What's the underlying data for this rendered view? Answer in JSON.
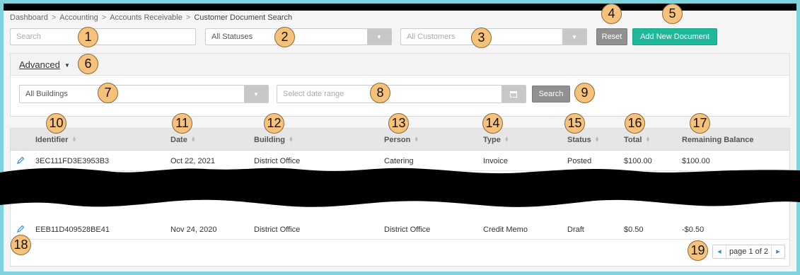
{
  "breadcrumb": {
    "items": [
      "Dashboard",
      "Accounting",
      "Accounts Receivable"
    ],
    "current": "Customer Document Search",
    "separator": ">"
  },
  "filters": {
    "search_placeholder": "Search",
    "status_value": "All Statuses",
    "customer_placeholder": "All Customers",
    "reset_label": "Reset",
    "add_label": "Add New Document"
  },
  "advanced": {
    "label": "Advanced",
    "building_placeholder": "All Buildings",
    "date_placeholder": "Select date range",
    "search_label": "Search"
  },
  "table": {
    "columns": [
      "Identifier",
      "Date",
      "Building",
      "Person",
      "Type",
      "Status",
      "Total",
      "Remaining Balance"
    ],
    "rows": [
      {
        "identifier": "3EC111FD3E3953B3",
        "date": "Oct 22, 2021",
        "building": "District Office",
        "person": "Catering",
        "type": "Invoice",
        "status": "Posted",
        "total": "$100.00",
        "remaining": "$100.00"
      },
      {
        "identifier": "EEB11D409528BE41",
        "date": "Nov 24, 2020",
        "building": "District Office",
        "person": "District Office",
        "type": "Credit Memo",
        "status": "Draft",
        "total": "$0.50",
        "remaining": "-$0.50"
      }
    ]
  },
  "pagination": {
    "text": "page 1 of 2"
  },
  "markers": [
    "1",
    "2",
    "3",
    "4",
    "5",
    "6",
    "7",
    "8",
    "9",
    "10",
    "11",
    "12",
    "13",
    "14",
    "15",
    "16",
    "17",
    "18",
    "19"
  ],
  "colors": {
    "background": "#7fd3dd",
    "accent": "#1fb89b",
    "marker": "#f6c27b",
    "link_icon": "#2a8fd8"
  }
}
